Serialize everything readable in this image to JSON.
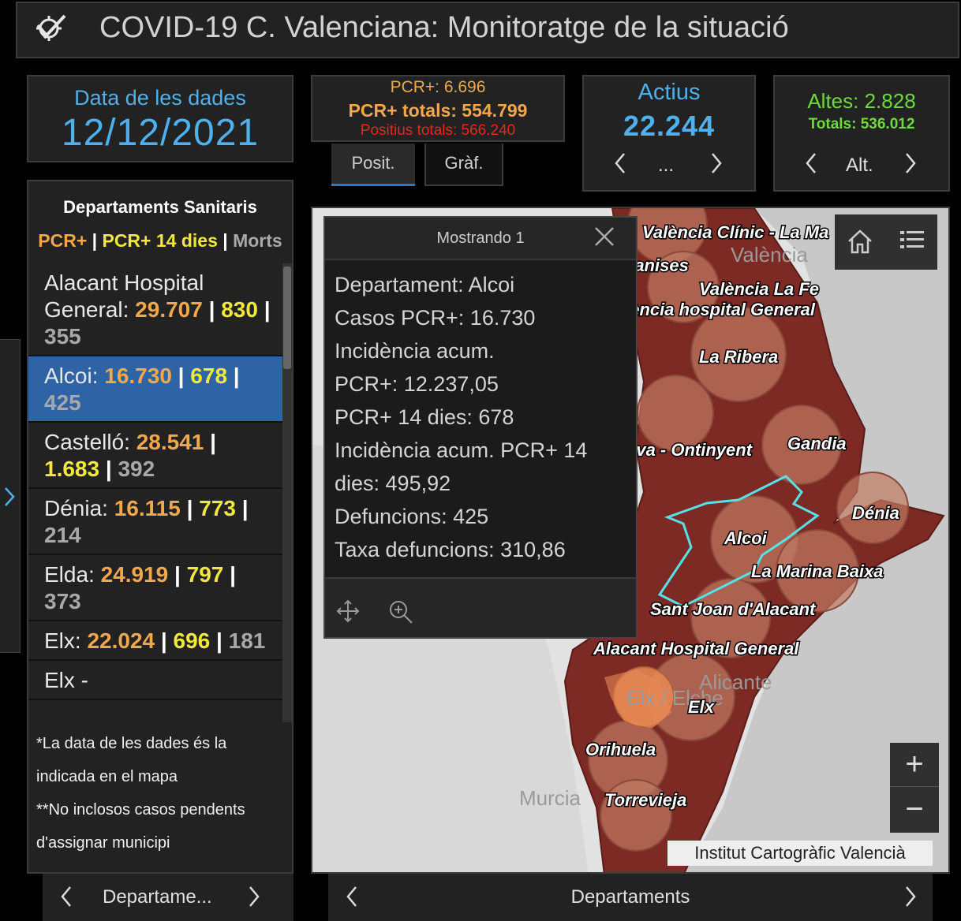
{
  "header": {
    "title": "COVID-19 C. Valenciana: Monitoratge de la situació",
    "logo_icon": "virus-strike-logo-icon"
  },
  "date": {
    "label": "Data de les dades",
    "value": "12/12/2021"
  },
  "pcr": {
    "daily": "PCR+: 6.696",
    "totals": "PCR+ totals: 554.799",
    "positive_totals": "Positius totals: 566.240"
  },
  "tabs": [
    {
      "label": "Posit."
    },
    {
      "label": "Gràf."
    }
  ],
  "actius": {
    "label": "Actius",
    "value": "22.244",
    "pager": "..."
  },
  "altes": {
    "label": "Altes: 2.828",
    "totals": "Totals: 536.012",
    "pager": "Alt."
  },
  "departments": {
    "title": "Departaments Sanitaris",
    "legend": {
      "pcr": "PCR+",
      "pcr14": "PCR+ 14 dies",
      "deaths": "Morts",
      "sep": " | "
    },
    "items": [
      {
        "name": "Alacant Hospital General: ",
        "pcr": "29.707",
        "pcr14": "830",
        "deaths": "355"
      },
      {
        "name": "Alcoi: ",
        "pcr": "16.730",
        "pcr14": "678",
        "deaths": "425"
      },
      {
        "name": "Castelló: ",
        "pcr": "28.541",
        "pcr14": "1.683",
        "deaths": "392"
      },
      {
        "name": "Dénia: ",
        "pcr": "16.115",
        "pcr14": "773",
        "deaths": "214"
      },
      {
        "name": "Elda: ",
        "pcr": "24.919",
        "pcr14": "797",
        "deaths": "373"
      },
      {
        "name": "Elx: ",
        "pcr": "22.024",
        "pcr14": "696",
        "deaths": "181"
      },
      {
        "name": "Elx -",
        "pcr": "",
        "pcr14": "",
        "deaths": ""
      }
    ],
    "notes": [
      "*La data de les dades és la indicada en el mapa",
      "**No inclosos casos pendents d'assignar municipi"
    ],
    "pager": "Departame..."
  },
  "popup": {
    "title": "Mostrando 1",
    "lines": [
      "Departament: Alcoi",
      "Casos PCR+: 16.730",
      "Incidència acum.",
      "PCR+: 12.237,05",
      "PCR+ 14 dies: 678",
      "Incidència acum. PCR+ 14",
      "dies: 495,92",
      "Defuncions: 425",
      "Taxa defuncions: 310,86"
    ]
  },
  "map": {
    "labels": [
      "València Clínic - La Ma",
      "Manises",
      "València La Fe",
      "València hospital General",
      "La Ribera",
      "Xàtiva - Ontinyent",
      "Gandia",
      "Dénia",
      "Alcoi",
      "La Marina Baixa",
      "Sant Joan d'Alacant",
      "Alacant Hospital General",
      "Elx",
      "Orihuela",
      "Torrevieja"
    ],
    "cities": [
      "València",
      "Alicante",
      "Murcia",
      "Elx / Elche"
    ],
    "attribution": "Institut Cartogràfic Valencià",
    "pager": "Departaments",
    "zoom_in": "+",
    "zoom_out": "−",
    "colors": {
      "region": "#7e2a24",
      "circle": "#c07a62",
      "highlight": "#57e0e6",
      "selected": "#e88a55"
    }
  }
}
